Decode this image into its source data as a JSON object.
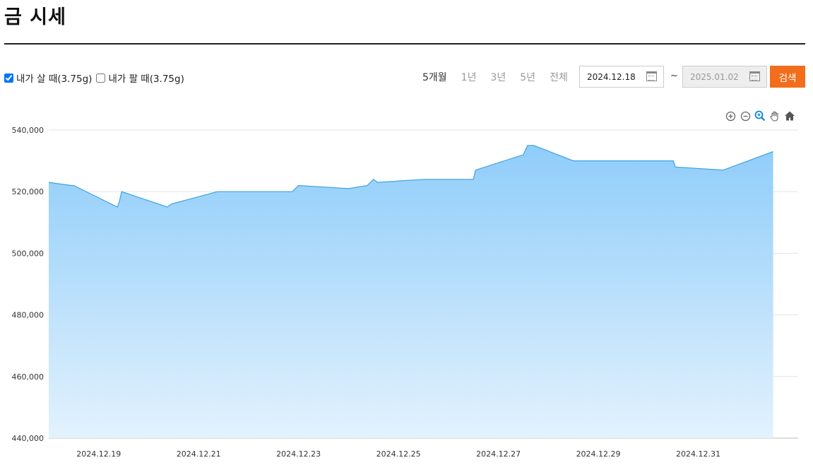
{
  "page": {
    "title": "금 시세"
  },
  "filters": {
    "buy_label": "내가 살 때(3.75g)",
    "buy_checked": true,
    "sell_label": "내가 팔 때(3.75g)",
    "sell_checked": false
  },
  "periods": [
    {
      "label": "5개월",
      "active": true
    },
    {
      "label": "1년",
      "active": false
    },
    {
      "label": "3년",
      "active": false
    },
    {
      "label": "5년",
      "active": false
    },
    {
      "label": "전체",
      "active": false
    }
  ],
  "date_range": {
    "start": "2024.12.18",
    "separator": "~",
    "end": "2025.01.02"
  },
  "search_label": "검색",
  "toolbar_icons": [
    "zoom-in-icon",
    "zoom-out-icon",
    "zoom-select-icon",
    "pan-hand-icon",
    "home-icon"
  ],
  "colors": {
    "accent": "#f26e1c",
    "series_line": "#3fa3e0",
    "area_top": "#8fcdfa",
    "area_bottom": "#e3f2fd"
  },
  "chart_data": {
    "type": "area",
    "title": "",
    "xlabel": "",
    "ylabel": "",
    "ylim": [
      440000,
      540000
    ],
    "y_ticks": [
      {
        "value": 540000,
        "label": "540,000"
      },
      {
        "value": 520000,
        "label": "520,000"
      },
      {
        "value": 500000,
        "label": "500,000"
      },
      {
        "value": 480000,
        "label": "480,000"
      },
      {
        "value": 460000,
        "label": "460,000"
      },
      {
        "value": 440000,
        "label": "440,000"
      }
    ],
    "x_range": [
      "2024-12-18",
      "2025-01-02"
    ],
    "x_ticks": [
      "2024.12.19",
      "2024.12.21",
      "2024.12.23",
      "2024.12.25",
      "2024.12.27",
      "2024.12.29",
      "2024.12.31"
    ],
    "grid": true,
    "series": [
      {
        "points": [
          {
            "x": "2024-12-18T00:00",
            "y": 523000
          },
          {
            "x": "2024-12-18T11:00",
            "y": 522000
          },
          {
            "x": "2024-12-18T12:00",
            "y": 522000
          },
          {
            "x": "2024-12-19T09:00",
            "y": 515000
          },
          {
            "x": "2024-12-19T10:00",
            "y": 517000
          },
          {
            "x": "2024-12-19T11:00",
            "y": 520000
          },
          {
            "x": "2024-12-20T09:00",
            "y": 515000
          },
          {
            "x": "2024-12-20T11:00",
            "y": 516000
          },
          {
            "x": "2024-12-21T09:00",
            "y": 520000
          },
          {
            "x": "2024-12-22T21:00",
            "y": 520000
          },
          {
            "x": "2024-12-23T00:00",
            "y": 522000
          },
          {
            "x": "2024-12-24T00:00",
            "y": 521000
          },
          {
            "x": "2024-12-24T09:00",
            "y": 522000
          },
          {
            "x": "2024-12-24T12:00",
            "y": 524000
          },
          {
            "x": "2024-12-24T14:00",
            "y": 523000
          },
          {
            "x": "2024-12-25T12:00",
            "y": 524000
          },
          {
            "x": "2024-12-26T12:00",
            "y": 524000
          },
          {
            "x": "2024-12-26T13:00",
            "y": 527000
          },
          {
            "x": "2024-12-27T12:00",
            "y": 532000
          },
          {
            "x": "2024-12-27T14:00",
            "y": 535000
          },
          {
            "x": "2024-12-27T17:00",
            "y": 535000
          },
          {
            "x": "2024-12-28T12:00",
            "y": 530000
          },
          {
            "x": "2024-12-30T12:00",
            "y": 530000
          },
          {
            "x": "2024-12-30T13:00",
            "y": 528000
          },
          {
            "x": "2024-12-31T12:00",
            "y": 527000
          },
          {
            "x": "2025-01-01T12:00",
            "y": 533000
          }
        ]
      }
    ]
  }
}
